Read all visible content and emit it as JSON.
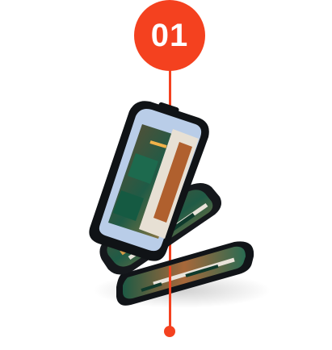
{
  "step": {
    "number": "01",
    "color": "#f4411f"
  },
  "illustration": {
    "subject": "stacked-smartphones",
    "screen_content": "isometric-apartment-floor-plan",
    "phone_count": 3
  }
}
